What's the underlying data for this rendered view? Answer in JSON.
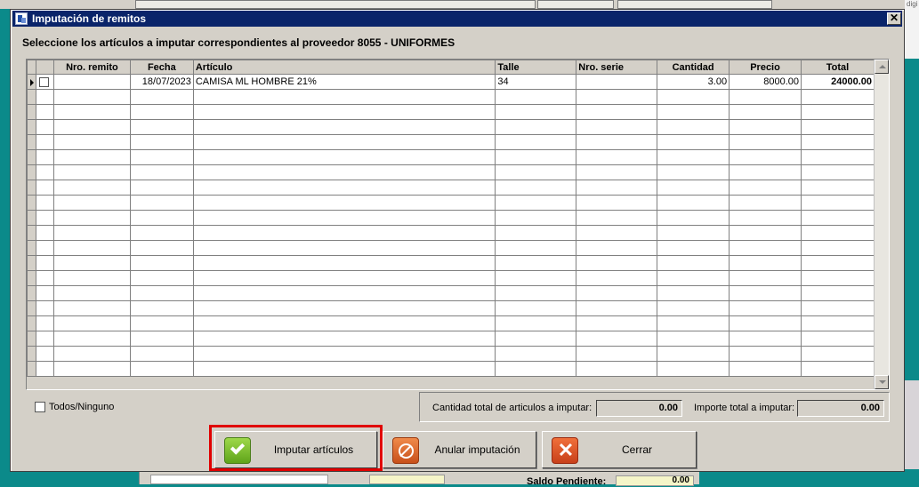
{
  "background": {
    "right_panel_text": "digi",
    "saldo_label": "Saldo Pendiente:",
    "saldo_value": "0.00"
  },
  "dialog": {
    "title": "Imputación de remitos",
    "close_glyph": "✕",
    "subtitle": "Seleccione los artículos a imputar correspondientes al proveedor 8055 - UNIFORMES"
  },
  "grid": {
    "columns": [
      "Nro. remito",
      "Fecha",
      "Artículo",
      "Talle",
      "Nro. serie",
      "Cantidad",
      "Precio",
      "Total"
    ],
    "rows": [
      {
        "nro_remito": "",
        "fecha": "18/07/2023",
        "articulo": "CAMISA ML HOMBRE 21%",
        "talle": "34",
        "nro_serie": "",
        "cantidad": "3.00",
        "precio": "8000.00",
        "total": "24000.00"
      }
    ]
  },
  "footer": {
    "todos_label": "Todos/Ninguno",
    "cantidad_label": "Cantidad total de articulos a imputar:",
    "cantidad_value": "0.00",
    "importe_label": "Importe total a imputar:",
    "importe_value": "0.00"
  },
  "buttons": {
    "imputar": "Imputar artículos",
    "anular": "Anular imputación",
    "cerrar": "Cerrar"
  },
  "colors": {
    "title_bar": "#0a246a",
    "highlight": "#e00000",
    "desktop": "#0b8a8a"
  }
}
